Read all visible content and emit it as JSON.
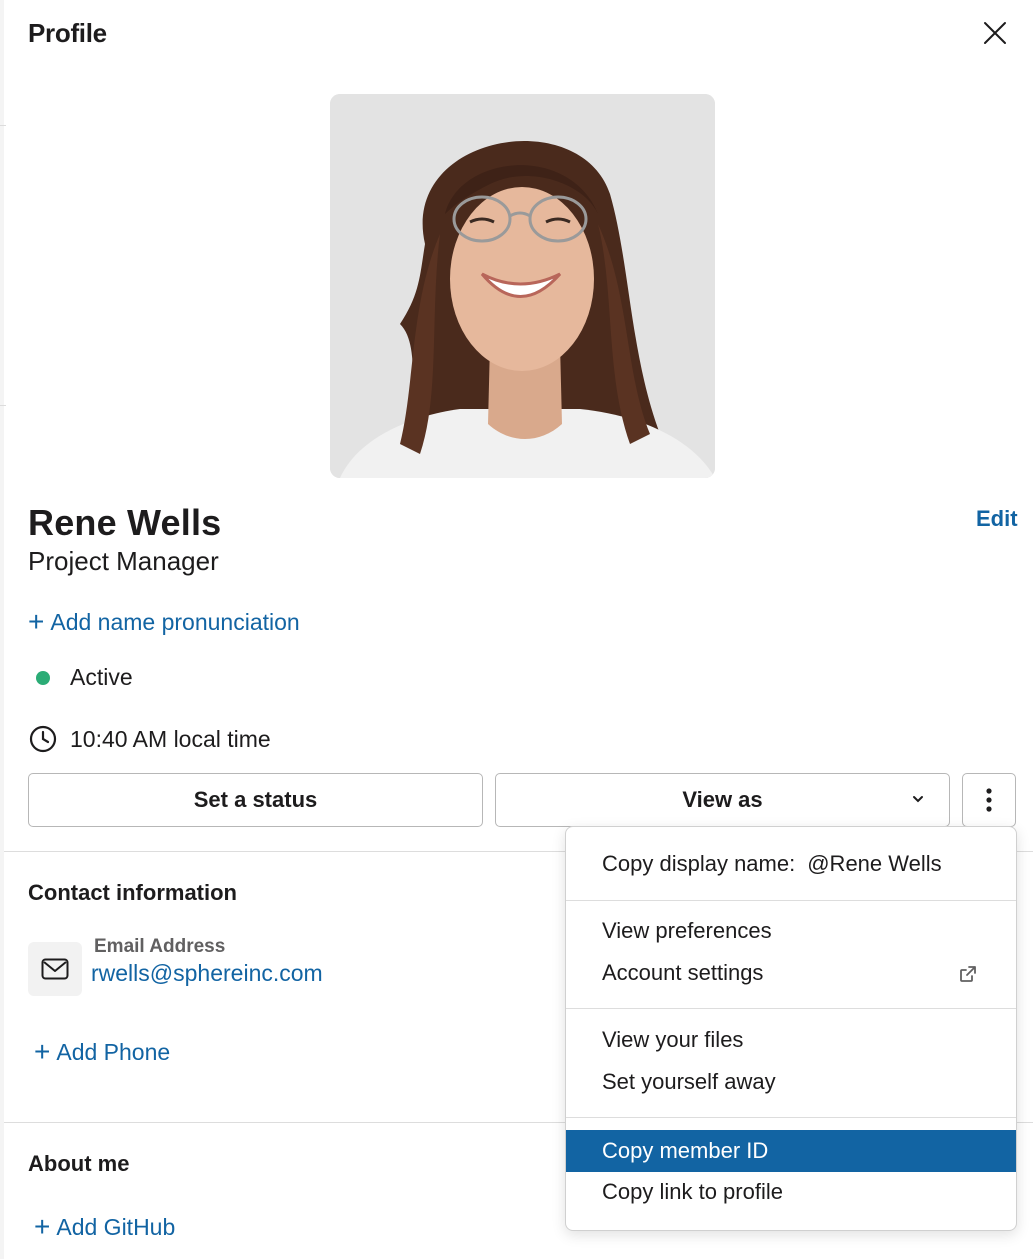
{
  "header": {
    "title": "Profile"
  },
  "profile": {
    "name": "Rene Wells",
    "job_title": "Project Manager",
    "edit_label": "Edit",
    "add_pronunciation": "Add name pronunciation",
    "status_text": "Active",
    "local_time": "10:40 AM local time"
  },
  "actions": {
    "set_status": "Set a status",
    "view_as": "View as"
  },
  "contact": {
    "heading": "Contact information",
    "email_label": "Email Address",
    "email_value": "rwells@sphereinc.com",
    "add_phone": "Add Phone"
  },
  "about": {
    "heading": "About me",
    "add_github": "Add GitHub"
  },
  "menu": {
    "copy_display_name_label": "Copy display name:",
    "copy_display_name_value": "@Rene Wells",
    "view_preferences": "View preferences",
    "account_settings": "Account settings",
    "view_files": "View your files",
    "set_away": "Set yourself away",
    "copy_member_id": "Copy member ID",
    "copy_link": "Copy link to profile"
  },
  "colors": {
    "link": "#1264a3",
    "active_dot": "#2bac76",
    "menu_highlight": "#1264a3"
  }
}
